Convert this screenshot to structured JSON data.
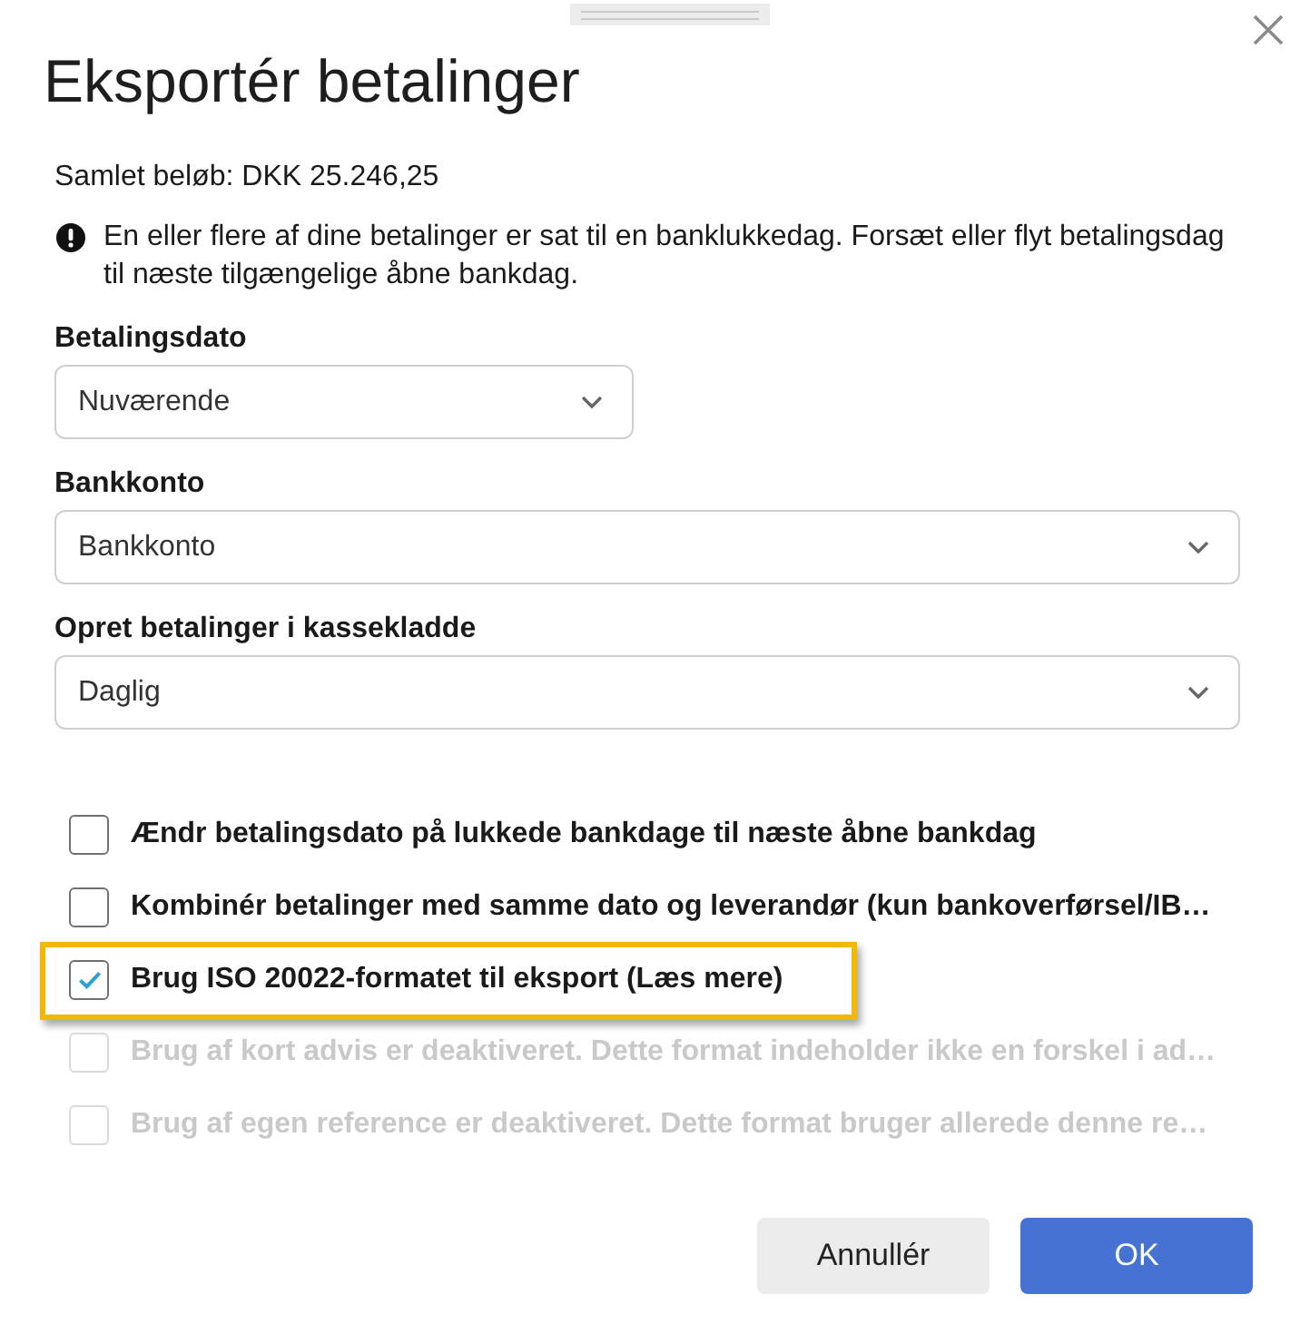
{
  "dialog": {
    "title": "Eksportér betalinger"
  },
  "summary": "Samlet beløb: DKK 25.246,25",
  "warning": {
    "text": "En eller flere af dine betalinger er sat til en banklukkedag. Forsæt eller flyt betalingsdag til næste tilgængelige åbne bankdag."
  },
  "fields": [
    {
      "kind": "date",
      "label": "Betalingsdato",
      "value": "Nuværende"
    },
    {
      "kind": "select",
      "label": "Bankkonto",
      "value": "Bankkonto"
    },
    {
      "kind": "select",
      "label": "Opret betalinger i kassekladde",
      "value": "Daglig"
    }
  ],
  "options": [
    {
      "label": "Ændr betalingsdato på lukkede bankdage til næste åbne bankdag",
      "checked": false,
      "disabled": false,
      "highlighted": false
    },
    {
      "label": "Kombinér betalinger med samme dato og leverandør (kun bankoverførsel/IB…",
      "checked": false,
      "disabled": false,
      "highlighted": false
    },
    {
      "label": "Brug ISO 20022-formatet til eksport (Læs mere)",
      "checked": true,
      "disabled": false,
      "highlighted": true
    },
    {
      "label": "Brug af kort advis er deaktiveret. Dette format indeholder ikke en forskel i ad…",
      "checked": false,
      "disabled": true,
      "highlighted": false
    },
    {
      "label": "Brug af egen reference er deaktiveret. Dette format bruger allerede denne re…",
      "checked": false,
      "disabled": true,
      "highlighted": false
    }
  ],
  "buttons": [
    {
      "kind": "secondary",
      "label": "Annullér"
    },
    {
      "kind": "primary",
      "label": "OK"
    }
  ]
}
